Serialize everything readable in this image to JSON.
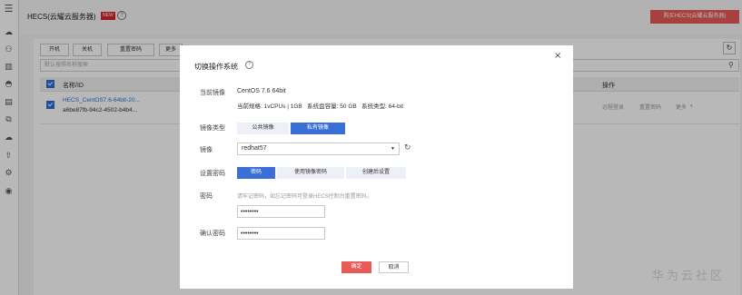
{
  "sidebar": {
    "icons": [
      "menu-icon",
      "cloud-icon",
      "cluster-icon",
      "storage-icon",
      "database-icon",
      "server-icon",
      "network-icon",
      "backup-icon",
      "upload-icon",
      "settings-icon",
      "security-icon"
    ]
  },
  "header": {
    "title": "HECS(云耀云服务器)",
    "badge": "NEW",
    "help": "?",
    "buy_button": "购买HECS(云耀云服务器)"
  },
  "toolbar": {
    "start": "开机",
    "stop": "关机",
    "reset_password": "重置密码",
    "more": "更多"
  },
  "search": {
    "placeholder": "默认按照名称搜索"
  },
  "table": {
    "headers": {
      "name": "名称/ID",
      "ops": "操作"
    },
    "row": {
      "name": "HECS_CentOS7.6-64bit-20...",
      "id": "a6be87fb-94c2-4502-b4b4...",
      "ops": {
        "remote_login": "远程登录",
        "reset_password": "重置密码",
        "more": "更多"
      }
    }
  },
  "modal": {
    "title": "切换操作系统",
    "close": "×",
    "current_image_label": "当前镜像",
    "current_image": "CentOS 7.6 64bit",
    "spec": "当前规格: 1vCPUs | 1GB   系统盘容量: 50 GB   系统类型: 64-bit",
    "image_type_label": "镜像类型",
    "image_types": [
      "公共镜像",
      "私有镜像"
    ],
    "image_label": "镜像",
    "image_value": "redhat57",
    "set_password_label": "设置密码",
    "password_modes": [
      "密码",
      "使用镜像密码",
      "创建后设置"
    ],
    "password_label": "密码",
    "password_hint": "请牢记密码，如忘记密码可登录HECS控制台重置密码。",
    "password_value": "••••••••",
    "confirm_label": "确认密码",
    "confirm_value": "••••••••",
    "ok": "确定",
    "cancel": "取消"
  },
  "watermark": "华为云社区",
  "colors": {
    "primary": "#3a6fd8",
    "danger": "#e95955",
    "link": "#2c6fd1"
  }
}
